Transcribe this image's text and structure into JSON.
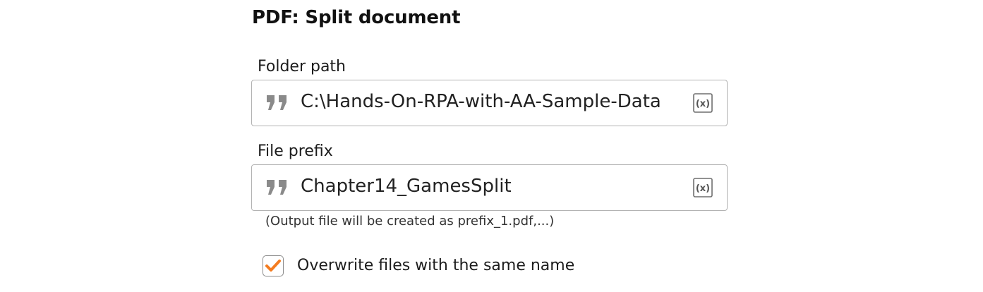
{
  "panel": {
    "title": "PDF: Split document"
  },
  "folder_path": {
    "label": "Folder path",
    "value": "C:\\Hands-On-RPA-with-AA-Sample-Data",
    "value_type_icon": "quote-icon",
    "variable_icon": "insert-variable-icon"
  },
  "file_prefix": {
    "label": "File prefix",
    "value": "Chapter14_GamesSplit",
    "value_type_icon": "quote-icon",
    "variable_icon": "insert-variable-icon",
    "hint": "(Output file will be created as prefix_1.pdf,...)"
  },
  "overwrite": {
    "label": "Overwrite files with the same name",
    "checked": true
  },
  "colors": {
    "checkmark": "#f47c20",
    "icon_gray": "#8a8a8a",
    "border": "#b3b3b3"
  }
}
